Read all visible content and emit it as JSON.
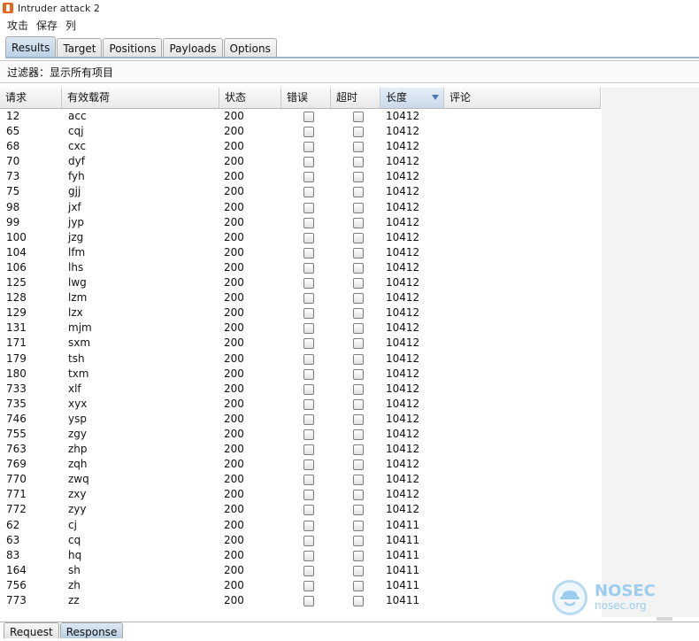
{
  "window": {
    "title": "Intruder attack 2"
  },
  "menu": [
    "攻击",
    "保存",
    "列"
  ],
  "tabs": [
    {
      "label": "Results",
      "active": true
    },
    {
      "label": "Target"
    },
    {
      "label": "Positions"
    },
    {
      "label": "Payloads"
    },
    {
      "label": "Options"
    }
  ],
  "filter": {
    "text": "过滤器：显示所有项目"
  },
  "table": {
    "columns": [
      "请求",
      "有效载荷",
      "状态",
      "错误",
      "超时",
      "长度",
      "评论"
    ],
    "sorted_column": "长度",
    "rows": [
      {
        "request": "12",
        "payload": "acc",
        "status": "200",
        "error": false,
        "timeout": false,
        "length": "10412",
        "comment": ""
      },
      {
        "request": "65",
        "payload": "cqj",
        "status": "200",
        "error": false,
        "timeout": false,
        "length": "10412",
        "comment": ""
      },
      {
        "request": "68",
        "payload": "cxc",
        "status": "200",
        "error": false,
        "timeout": false,
        "length": "10412",
        "comment": ""
      },
      {
        "request": "70",
        "payload": "dyf",
        "status": "200",
        "error": false,
        "timeout": false,
        "length": "10412",
        "comment": ""
      },
      {
        "request": "73",
        "payload": "fyh",
        "status": "200",
        "error": false,
        "timeout": false,
        "length": "10412",
        "comment": ""
      },
      {
        "request": "75",
        "payload": "gjj",
        "status": "200",
        "error": false,
        "timeout": false,
        "length": "10412",
        "comment": ""
      },
      {
        "request": "98",
        "payload": "jxf",
        "status": "200",
        "error": false,
        "timeout": false,
        "length": "10412",
        "comment": ""
      },
      {
        "request": "99",
        "payload": "jyp",
        "status": "200",
        "error": false,
        "timeout": false,
        "length": "10412",
        "comment": ""
      },
      {
        "request": "100",
        "payload": "jzg",
        "status": "200",
        "error": false,
        "timeout": false,
        "length": "10412",
        "comment": ""
      },
      {
        "request": "104",
        "payload": "lfm",
        "status": "200",
        "error": false,
        "timeout": false,
        "length": "10412",
        "comment": ""
      },
      {
        "request": "106",
        "payload": "lhs",
        "status": "200",
        "error": false,
        "timeout": false,
        "length": "10412",
        "comment": ""
      },
      {
        "request": "125",
        "payload": "lwg",
        "status": "200",
        "error": false,
        "timeout": false,
        "length": "10412",
        "comment": ""
      },
      {
        "request": "128",
        "payload": "lzm",
        "status": "200",
        "error": false,
        "timeout": false,
        "length": "10412",
        "comment": ""
      },
      {
        "request": "129",
        "payload": "lzx",
        "status": "200",
        "error": false,
        "timeout": false,
        "length": "10412",
        "comment": ""
      },
      {
        "request": "131",
        "payload": "mjm",
        "status": "200",
        "error": false,
        "timeout": false,
        "length": "10412",
        "comment": ""
      },
      {
        "request": "171",
        "payload": "sxm",
        "status": "200",
        "error": false,
        "timeout": false,
        "length": "10412",
        "comment": ""
      },
      {
        "request": "179",
        "payload": "tsh",
        "status": "200",
        "error": false,
        "timeout": false,
        "length": "10412",
        "comment": ""
      },
      {
        "request": "180",
        "payload": "txm",
        "status": "200",
        "error": false,
        "timeout": false,
        "length": "10412",
        "comment": ""
      },
      {
        "request": "733",
        "payload": "xlf",
        "status": "200",
        "error": false,
        "timeout": false,
        "length": "10412",
        "comment": ""
      },
      {
        "request": "735",
        "payload": "xyx",
        "status": "200",
        "error": false,
        "timeout": false,
        "length": "10412",
        "comment": ""
      },
      {
        "request": "746",
        "payload": "ysp",
        "status": "200",
        "error": false,
        "timeout": false,
        "length": "10412",
        "comment": ""
      },
      {
        "request": "755",
        "payload": "zgy",
        "status": "200",
        "error": false,
        "timeout": false,
        "length": "10412",
        "comment": ""
      },
      {
        "request": "763",
        "payload": "zhp",
        "status": "200",
        "error": false,
        "timeout": false,
        "length": "10412",
        "comment": ""
      },
      {
        "request": "769",
        "payload": "zqh",
        "status": "200",
        "error": false,
        "timeout": false,
        "length": "10412",
        "comment": ""
      },
      {
        "request": "770",
        "payload": "zwq",
        "status": "200",
        "error": false,
        "timeout": false,
        "length": "10412",
        "comment": ""
      },
      {
        "request": "771",
        "payload": "zxy",
        "status": "200",
        "error": false,
        "timeout": false,
        "length": "10412",
        "comment": ""
      },
      {
        "request": "772",
        "payload": "zyy",
        "status": "200",
        "error": false,
        "timeout": false,
        "length": "10412",
        "comment": ""
      },
      {
        "request": "62",
        "payload": "cj",
        "status": "200",
        "error": false,
        "timeout": false,
        "length": "10411",
        "comment": ""
      },
      {
        "request": "63",
        "payload": "cq",
        "status": "200",
        "error": false,
        "timeout": false,
        "length": "10411",
        "comment": ""
      },
      {
        "request": "83",
        "payload": "hq",
        "status": "200",
        "error": false,
        "timeout": false,
        "length": "10411",
        "comment": ""
      },
      {
        "request": "164",
        "payload": "sh",
        "status": "200",
        "error": false,
        "timeout": false,
        "length": "10411",
        "comment": ""
      },
      {
        "request": "756",
        "payload": "zh",
        "status": "200",
        "error": false,
        "timeout": false,
        "length": "10411",
        "comment": ""
      },
      {
        "request": "773",
        "payload": "zz",
        "status": "200",
        "error": false,
        "timeout": false,
        "length": "10411",
        "comment": ""
      }
    ]
  },
  "bottom_tabs": [
    {
      "label": "Request"
    },
    {
      "label": "Response",
      "active": true
    }
  ],
  "watermark": {
    "brand": "NOSEC",
    "site": "nosec.org",
    "icon": "detective-hat-icon"
  },
  "colors": {
    "tab_active": "#c4d7ea",
    "sort_arrow": "#4a78b0",
    "watermark": "#9ccdef"
  }
}
